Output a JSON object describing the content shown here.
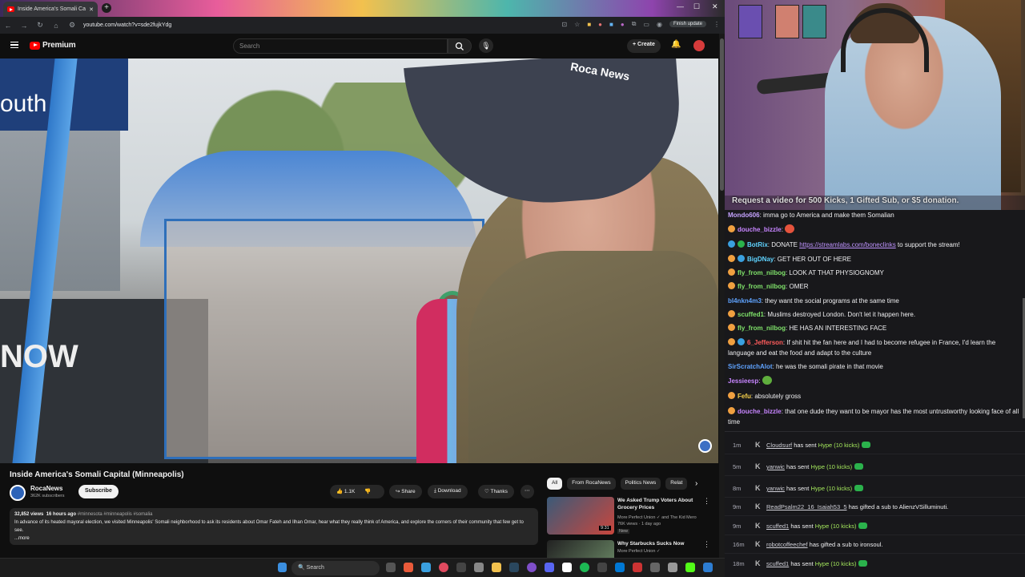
{
  "browser": {
    "tab_title": "Inside America's Somali Ca",
    "url": "youtube.com/watch?v=sde2fujkYdg",
    "finish_update": "Finish update"
  },
  "youtube": {
    "logo_text": "Premium",
    "search_placeholder": "Search",
    "create_label": "Create",
    "video": {
      "title": "Inside America's Somali Capital (Minneapolis)",
      "channel": "RocaNews",
      "subscribers": "362K subscribers",
      "subscribe_label": "Subscribe",
      "likes": "1.1K",
      "share_label": "Share",
      "download_label": "Download",
      "thanks_label": "Thanks",
      "views": "32,852 views",
      "age": "16 hours ago",
      "tags": "#minnesota #minneapolis #somalia",
      "description": "In advance of its heated mayoral election, we visited Minneapolis' Somali neighborhood to ask its residents about Omar Fateh and Ilhan Omar, hear what they really think of America, and explore the corners of their community that few get to see.",
      "more": "...more",
      "overlay_text_sign": "outh",
      "overlay_text_cap": "Roca News",
      "overlay_text_wall": "NOW"
    },
    "chips": [
      "All",
      "From RocaNews",
      "Politics News",
      "Relat"
    ],
    "recommendations": [
      {
        "title": "We Asked Trump Voters About Grocery Prices",
        "channel": "More Perfect Union",
        "channel_extra": "and The Kid Mero",
        "meta": "76K views · 1 day ago",
        "badge": "New",
        "duration": "9:31"
      },
      {
        "title": "Why Starbucks Sucks Now",
        "channel": "More Perfect Union",
        "channel_extra": "",
        "meta": "",
        "badge": "",
        "duration": ""
      }
    ]
  },
  "taskbar": {
    "search_label": "Search"
  },
  "stream": {
    "request_text": "Request a video for 500 Kicks, 1 Gifted Sub, or $5 donation."
  },
  "chat": [
    {
      "user": "Mondo606",
      "text": "imma go to America and make them Somalian",
      "color": "#c6a3ff",
      "badge": ""
    },
    {
      "user": "douche_bizzle",
      "text": "",
      "color": "#c785ff",
      "badge": "#f0a040",
      "emote": "#e5533d"
    },
    {
      "user": "BotRix",
      "text": "DONATE ",
      "link": "https://streamlabs.com/boneclinks",
      "text_after": " to support the stream!",
      "color": "#5fd3ff",
      "badge": "#2bb24c"
    },
    {
      "user": "BigDNay",
      "text": "GET HER OUT OF HERE",
      "color": "#5fd3ff",
      "badge": "#3aa0e0"
    },
    {
      "user": "fly_from_nilbog",
      "text": "LOOK AT THAT PHYSIOGNOMY",
      "color": "#7fe26a",
      "badge": "#f0a040"
    },
    {
      "user": "fly_from_nilbog",
      "text": "OMER",
      "color": "#7fe26a",
      "badge": "#f0a040"
    },
    {
      "user": "bl4nkn4m3",
      "text": "they want the social programs at the same time",
      "color": "#5fa3ff",
      "badge": ""
    },
    {
      "user": "scuffed1",
      "text": "Muslims destroyed London. Don't let it happen here.",
      "color": "#7fe26a",
      "badge": "#f0a040"
    },
    {
      "user": "fly_from_nilbog",
      "text": "HE HAS AN INTERESTING FACE",
      "color": "#7fe26a",
      "badge": "#f0a040"
    },
    {
      "user": "6_Jefferson",
      "text": "If shit hit the fan here and I had to become refugee in France, I'd learn the language and eat the food and adapt to the culture",
      "color": "#ff5c5c",
      "badge": "#3aa0e0"
    },
    {
      "user": "SirScratchAlot",
      "text": "he was the somali pirate in that movie",
      "color": "#5fa3ff",
      "badge": ""
    },
    {
      "user": "Jessieesp",
      "text": "",
      "color": "#c785ff",
      "badge": "",
      "emote": "#5fae3d"
    },
    {
      "user": "Fefu",
      "text": "absolutely gross",
      "color": "#f7d14a",
      "badge": "#f0a040"
    },
    {
      "user": "douche_bizzle",
      "text": "that one dude they want to be mayor has the most untrustworthy looking face of all time",
      "color": "#c785ff",
      "badge": "#f0a040"
    }
  ],
  "events": [
    {
      "time": "1m",
      "user": "Cloudsurf",
      "action": "has sent",
      "highlight": "Hype (10 kicks)",
      "icon": true
    },
    {
      "time": "5m",
      "user": "yanwic",
      "action": "has sent",
      "highlight": "Hype (10 kicks)",
      "icon": true
    },
    {
      "time": "8m",
      "user": "yanwic",
      "action": "has sent",
      "highlight": "Hype (10 kicks)",
      "icon": true
    },
    {
      "time": "9m",
      "user": "ReadPsalm22_16_Isaiah53_5",
      "action": "has gifted a sub to",
      "highlight": "AlienzVSilluminuti.",
      "icon": false
    },
    {
      "time": "9m",
      "user": "scuffed1",
      "action": "has sent",
      "highlight": "Hype (10 kicks)",
      "icon": true
    },
    {
      "time": "16m",
      "user": "robotcoffeechef",
      "action": "has gifted a sub to",
      "highlight": "ironsoul.",
      "icon": false
    },
    {
      "time": "18m",
      "user": "scuffed1",
      "action": "has sent",
      "highlight": "Hype (10 kicks)",
      "icon": true
    }
  ]
}
